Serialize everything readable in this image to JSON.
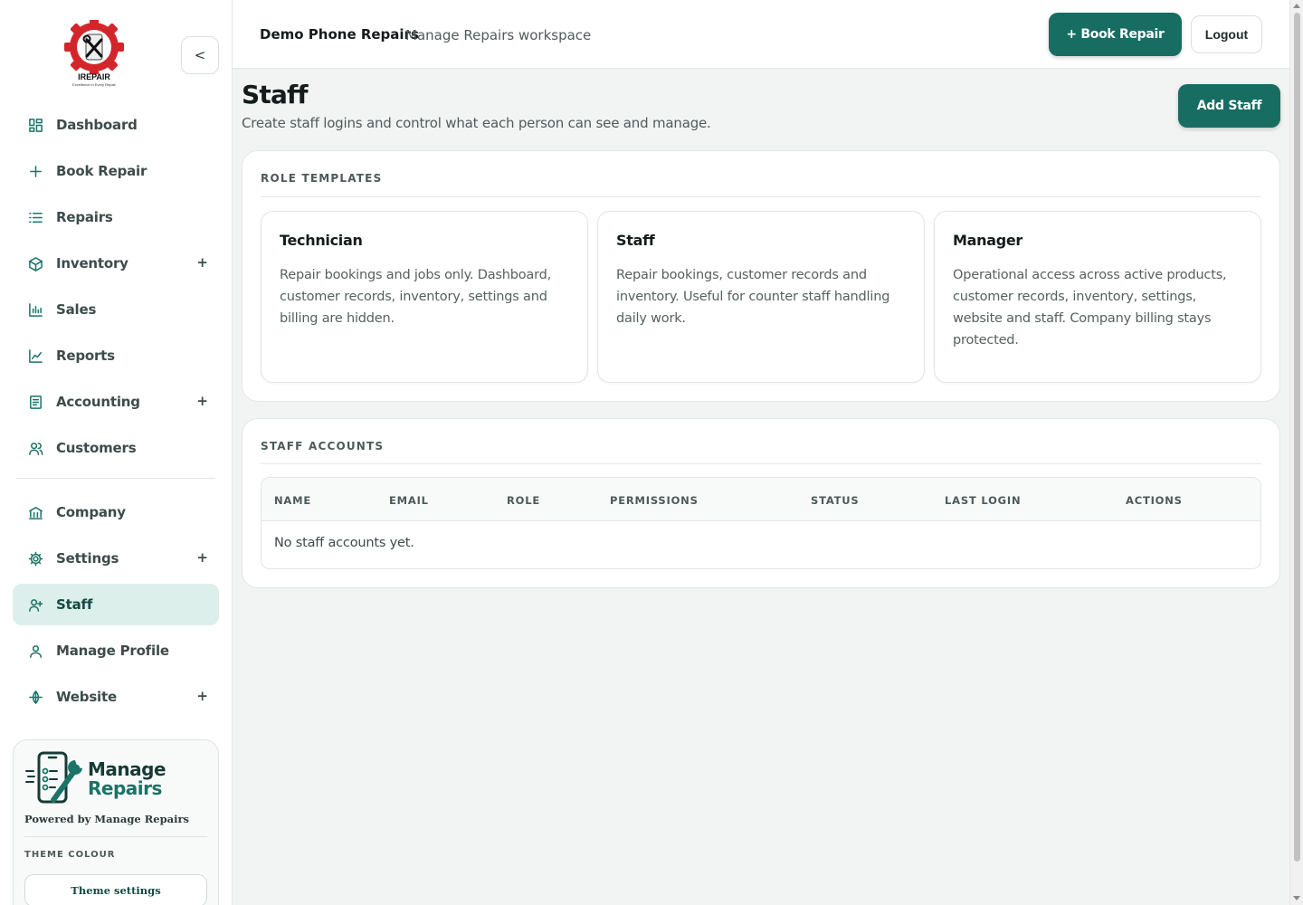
{
  "sidebar": {
    "logo_text": "IREPAIR",
    "logo_tagline": "Excellence in Every Repair",
    "collapse_label": "<",
    "items": [
      {
        "label": "Dashboard",
        "icon": "dashboard-icon",
        "expandable": false
      },
      {
        "label": "Book Repair",
        "icon": "plus-icon",
        "expandable": false
      },
      {
        "label": "Repairs",
        "icon": "list-icon",
        "expandable": false
      },
      {
        "label": "Inventory",
        "icon": "box-icon",
        "expandable": true
      },
      {
        "label": "Sales",
        "icon": "bar-chart-icon",
        "expandable": false
      },
      {
        "label": "Reports",
        "icon": "line-chart-icon",
        "expandable": false
      },
      {
        "label": "Accounting",
        "icon": "ledger-icon",
        "expandable": true
      },
      {
        "label": "Customers",
        "icon": "users-icon",
        "expandable": false
      }
    ],
    "items2": [
      {
        "label": "Company",
        "icon": "bank-icon",
        "expandable": false
      },
      {
        "label": "Settings",
        "icon": "gear-icon",
        "expandable": true
      },
      {
        "label": "Staff",
        "icon": "user-plus-icon",
        "expandable": false,
        "active": true
      },
      {
        "label": "Manage Profile",
        "icon": "user-icon",
        "expandable": false
      },
      {
        "label": "Website",
        "icon": "globe-icon",
        "expandable": true
      }
    ],
    "plus_symbol": "+",
    "brand_word1": "Manage",
    "brand_word2": "Repairs",
    "powered_by": "Powered by Manage Repairs",
    "theme_label": "THEME COLOUR",
    "theme_button": "Theme settings"
  },
  "topbar": {
    "company_name": "Demo Phone Repairs",
    "workspace": "Manage Repairs workspace",
    "book_repair": "+ Book Repair",
    "logout": "Logout"
  },
  "page": {
    "title": "Staff",
    "subtitle": "Create staff logins and control what each person can see and manage.",
    "add_staff": "Add Staff"
  },
  "role_templates": {
    "heading": "ROLE TEMPLATES",
    "cards": [
      {
        "title": "Technician",
        "description": "Repair bookings and jobs only. Dashboard, customer records, inventory, settings and billing are hidden."
      },
      {
        "title": "Staff",
        "description": "Repair bookings, customer records and inventory. Useful for counter staff handling daily work."
      },
      {
        "title": "Manager",
        "description": "Operational access across active products, customer records, inventory, settings, website and staff. Company billing stays protected."
      }
    ]
  },
  "staff_accounts": {
    "heading": "STAFF ACCOUNTS",
    "columns": [
      "NAME",
      "EMAIL",
      "ROLE",
      "PERMISSIONS",
      "STATUS",
      "LAST LOGIN",
      "ACTIONS"
    ],
    "empty_message": "No staff accounts yet."
  },
  "colors": {
    "accent": "#176d62",
    "active_bg": "#dcefeb",
    "logo_red": "#d3262b"
  }
}
